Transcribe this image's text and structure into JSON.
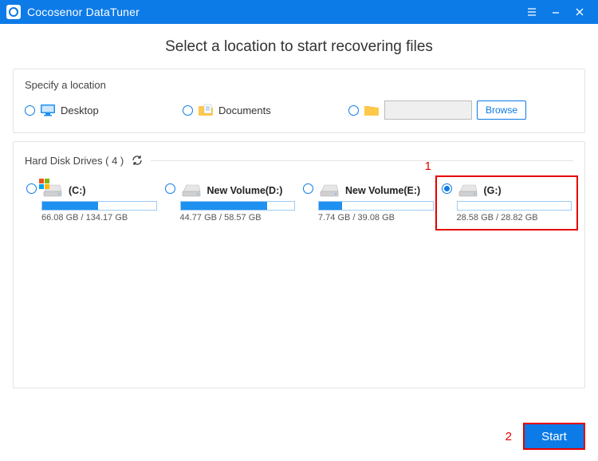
{
  "app": {
    "title": "Cocosenor DataTuner"
  },
  "heading": "Select a location to start recovering files",
  "location_panel": {
    "title": "Specify a location",
    "desktop": "Desktop",
    "documents": "Documents",
    "browse": "Browse"
  },
  "drives_panel": {
    "title": "Hard Disk Drives ( 4 )"
  },
  "drives": [
    {
      "name": "(C:)",
      "size": "66.08 GB / 134.17 GB",
      "fill": 49,
      "os": true,
      "selected": false
    },
    {
      "name": "New Volume(D:)",
      "size": "44.77 GB / 58.57 GB",
      "fill": 76,
      "os": false,
      "selected": false
    },
    {
      "name": "New Volume(E:)",
      "size": "7.74 GB / 39.08 GB",
      "fill": 20,
      "os": false,
      "selected": false
    },
    {
      "name": "(G:)",
      "size": "28.58 GB / 28.82 GB",
      "fill": 0,
      "os": false,
      "selected": true
    }
  ],
  "annotations": {
    "one": "1",
    "two": "2"
  },
  "footer": {
    "start": "Start"
  }
}
